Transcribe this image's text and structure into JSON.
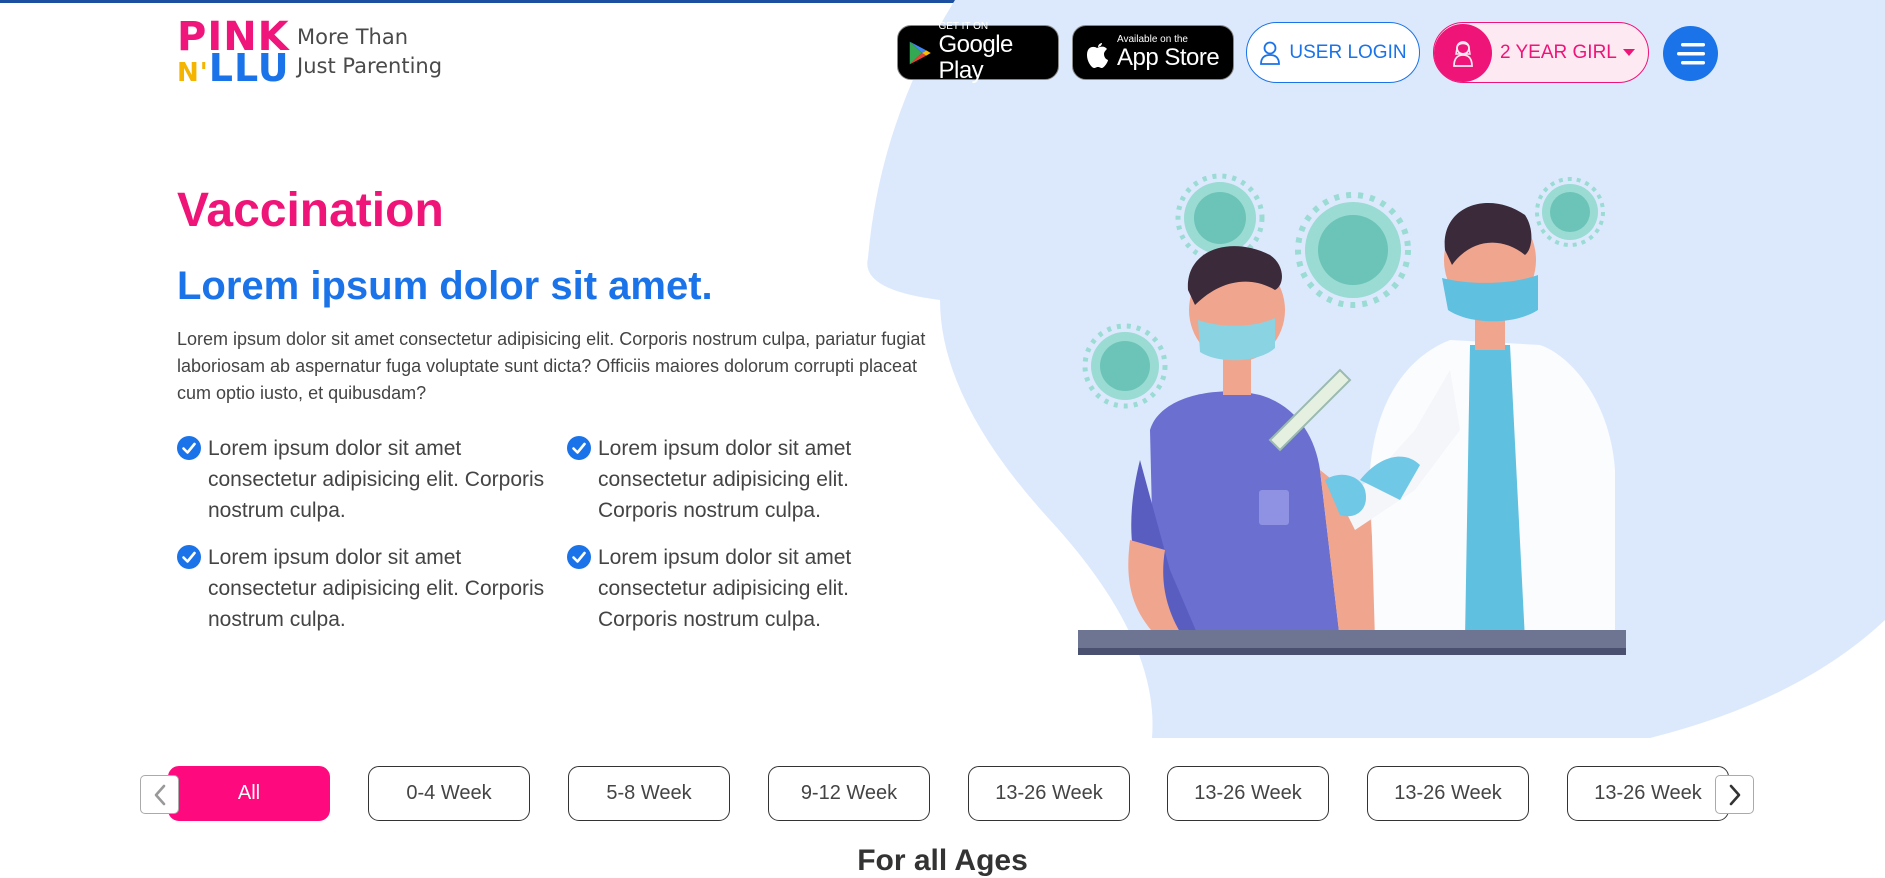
{
  "colors": {
    "brand_pink": "#ef1478",
    "brand_blue": "#1a73e8",
    "blob": "#dce9fd",
    "chip_active": "#ff0a7e"
  },
  "header": {
    "logo_top": "PINK",
    "logo_bottom_n": "N'",
    "logo_bottom_llu": "LLU",
    "tagline_line1": "More Than",
    "tagline_line2": "Just Parenting",
    "google_play": {
      "small": "GET IT ON",
      "big": "Google Play",
      "icon": "google-play-icon"
    },
    "app_store": {
      "small": "Available on the",
      "big": "App Store",
      "icon": "apple-icon"
    },
    "login_label": "USER LOGIN",
    "profile_label": "2 YEAR GIRL",
    "menu_icon": "hamburger-icon"
  },
  "hero": {
    "title": "Vaccination",
    "subtitle": "Lorem ipsum dolor sit amet.",
    "description": "Lorem ipsum dolor sit amet consectetur adipisicing elit. Corporis nostrum culpa, pariatur fugiat laboriosam ab aspernatur fuga voluptate sunt dicta? Officiis maiores dolorum corrupti placeat cum optio iusto, et quibusdam?",
    "features": [
      "Lorem ipsum dolor sit amet consectetur adipisicing elit. Corporis nostrum culpa.",
      "Lorem ipsum dolor sit amet consectetur adipisicing elit. Corporis nostrum culpa.",
      "Lorem ipsum dolor sit amet consectetur adipisicing elit. Corporis nostrum culpa.",
      "Lorem ipsum dolor sit amet consectetur adipisicing elit. Corporis nostrum culpa."
    ]
  },
  "filters": {
    "chips": [
      "All",
      "0-4 Week",
      "5-8 Week",
      "9-12 Week",
      "13-26 Week",
      "13-26 Week",
      "13-26 Week",
      "13-26 Week"
    ],
    "active_index": 0
  },
  "section": {
    "title": "For all Ages"
  }
}
